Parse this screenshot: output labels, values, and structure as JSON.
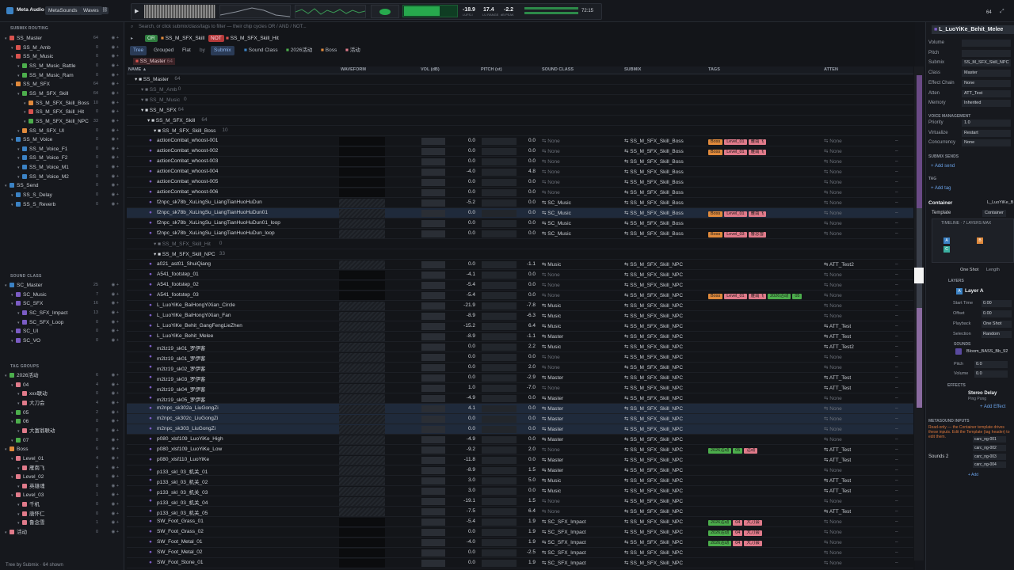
{
  "app": {
    "title": "Meta Audio",
    "tabs": [
      "MetaSounds",
      "Waves"
    ]
  },
  "meters": {
    "lufs_i": "-18.9",
    "lufs_lra": "17.4",
    "lufs_peak": "-2.2",
    "lufs_i_label": "LUFS-I",
    "lra_label": "LU RANGE",
    "peak_label": "dB PEAK",
    "time": "72:15",
    "zoom": "64"
  },
  "sidebar": {
    "routing_title": "SUBMIX ROUTING",
    "routing": [
      {
        "label": "SS_Master",
        "cnt": "64",
        "color": "#d9534f",
        "lvl": 0
      },
      {
        "label": "SS_M_Amb",
        "cnt": "0",
        "color": "#d9534f",
        "lvl": 1
      },
      {
        "label": "SS_M_Music",
        "cnt": "0",
        "color": "#d9534f",
        "lvl": 1
      },
      {
        "label": "SS_M_Music_Battle",
        "cnt": "0",
        "color": "#4cae4c",
        "lvl": 2
      },
      {
        "label": "SS_M_Music_Ram",
        "cnt": "0",
        "color": "#4cae4c",
        "lvl": 2
      },
      {
        "label": "SS_M_SFX",
        "cnt": "64",
        "color": "#e08a3c",
        "lvl": 1
      },
      {
        "label": "SS_M_SFX_Skill",
        "cnt": "64",
        "color": "#4cae4c",
        "lvl": 2
      },
      {
        "label": "SS_M_SFX_Skill_Boss",
        "cnt": "10",
        "color": "#e08a3c",
        "lvl": 3
      },
      {
        "label": "SS_M_SFX_Skill_Hit",
        "cnt": "0",
        "color": "#d9534f",
        "lvl": 3
      },
      {
        "label": "SS_M_SFX_Skill_NPC",
        "cnt": "33",
        "color": "#4cae4c",
        "lvl": 3
      },
      {
        "label": "SS_M_SFX_UI",
        "cnt": "0",
        "color": "#e08a3c",
        "lvl": 2
      },
      {
        "label": "SS_M_Voice",
        "cnt": "0",
        "color": "#3b82c4",
        "lvl": 1
      },
      {
        "label": "SS_M_Voice_F1",
        "cnt": "0",
        "color": "#3b82c4",
        "lvl": 2
      },
      {
        "label": "SS_M_Voice_F2",
        "cnt": "0",
        "color": "#3b82c4",
        "lvl": 2
      },
      {
        "label": "SS_M_Voice_M1",
        "cnt": "0",
        "color": "#3b82c4",
        "lvl": 2
      },
      {
        "label": "SS_M_Voice_M2",
        "cnt": "0",
        "color": "#3b82c4",
        "lvl": 2
      },
      {
        "label": "SS_Send",
        "cnt": "0",
        "color": "#3b82c4",
        "lvl": 0
      },
      {
        "label": "SS_S_Delay",
        "cnt": "0",
        "color": "#3b82c4",
        "lvl": 1
      },
      {
        "label": "SS_S_Reverb",
        "cnt": "0",
        "color": "#3b82c4",
        "lvl": 1
      }
    ],
    "class_title": "SOUND CLASS",
    "classes": [
      {
        "label": "SC_Master",
        "cnt": "25",
        "color": "#3b82c4",
        "lvl": 0
      },
      {
        "label": "SC_Music",
        "cnt": "7",
        "color": "#7b5cc4",
        "lvl": 1
      },
      {
        "label": "SC_SFX",
        "cnt": "16",
        "color": "#7b5cc4",
        "lvl": 1
      },
      {
        "label": "SC_SFX_Impact",
        "cnt": "13",
        "color": "#7b5cc4",
        "lvl": 2
      },
      {
        "label": "SC_SFX_Loop",
        "cnt": "0",
        "color": "#7b5cc4",
        "lvl": 2
      },
      {
        "label": "SC_UI",
        "cnt": "0",
        "color": "#7b5cc4",
        "lvl": 1
      },
      {
        "label": "SC_VO",
        "cnt": "0",
        "color": "#7b5cc4",
        "lvl": 1
      }
    ],
    "tags_title": "TAG GROUPS",
    "tags": [
      {
        "label": "2026活动",
        "cnt": "6",
        "color": "#4cae4c",
        "lvl": 0
      },
      {
        "label": "04",
        "cnt": "4",
        "color": "#e07a8a",
        "lvl": 1
      },
      {
        "label": "xxx联动",
        "cnt": "0",
        "color": "#e07a8a",
        "lvl": 2
      },
      {
        "label": "大刀会",
        "cnt": "4",
        "color": "#e07a8a",
        "lvl": 2
      },
      {
        "label": "05",
        "cnt": "2",
        "color": "#4cae4c",
        "lvl": 1
      },
      {
        "label": "06",
        "cnt": "0",
        "color": "#4cae4c",
        "lvl": 1
      },
      {
        "label": "大富翁联动",
        "cnt": "0",
        "color": "#e07a8a",
        "lvl": 2
      },
      {
        "label": "07",
        "cnt": "0",
        "color": "#4cae4c",
        "lvl": 1
      },
      {
        "label": "Boss",
        "cnt": "6",
        "color": "#e08a3c",
        "lvl": 0
      },
      {
        "label": "Level_01",
        "cnt": "4",
        "color": "#e07a8a",
        "lvl": 1
      },
      {
        "label": "雁南飞",
        "cnt": "4",
        "color": "#e07a8a",
        "lvl": 2
      },
      {
        "label": "Level_02",
        "cnt": "0",
        "color": "#e07a8a",
        "lvl": 1
      },
      {
        "label": "英雄魂",
        "cnt": "0",
        "color": "#e07a8a",
        "lvl": 2
      },
      {
        "label": "Level_03",
        "cnt": "1",
        "color": "#e07a8a",
        "lvl": 1
      },
      {
        "label": "千机",
        "cnt": "0",
        "color": "#e07a8a",
        "lvl": 2
      },
      {
        "label": "唐怀仁",
        "cnt": "0",
        "color": "#e07a8a",
        "lvl": 2
      },
      {
        "label": "鲁念雪",
        "cnt": "1",
        "color": "#e07a8a",
        "lvl": 2
      },
      {
        "label": "活动",
        "cnt": "0",
        "color": "#e07a8a",
        "lvl": 0
      }
    ],
    "status": "Tree by Submix · 64 shown"
  },
  "main": {
    "search_placeholder": "Search, or click submix/class/tags to filter — their chip cycles OR / AND / NOT...",
    "chip_or": "OR",
    "chip_or_val": "SS_M_SFX_Skill",
    "chip_not": "NOT",
    "chip_not_val": "SS_M_SFX_Skill_Hit",
    "views": [
      "Tree",
      "Grouped",
      "Flat"
    ],
    "by": "by",
    "group_chips": [
      "Submix",
      "Sound Class",
      "2026活动",
      "Boss",
      "活动"
    ],
    "crumb": "SS_Master",
    "crumb_cnt": "64",
    "cols": [
      "NAME ▲",
      "WAVEFORM",
      "VOL (dB)",
      "PITCH (st)",
      "SOUND CLASS",
      "SUBMIX",
      "TAGS",
      "ATTEN"
    ]
  },
  "rows": [
    {
      "n": "SS_Master",
      "g": 1,
      "ind": 0,
      "c": "64"
    },
    {
      "n": "SS_M_Amb",
      "g": 1,
      "ind": 1,
      "c": "0",
      "dim": 1
    },
    {
      "n": "SS_M_Music",
      "g": 1,
      "ind": 1,
      "c": "0",
      "dim": 1
    },
    {
      "n": "SS_M_SFX",
      "g": 1,
      "ind": 1,
      "c": "64"
    },
    {
      "n": "SS_M_SFX_Skill",
      "g": 1,
      "ind": 2,
      "c": "64"
    },
    {
      "n": "SS_M_SFX_Skill_Boss",
      "g": 1,
      "ind": 3,
      "c": "10"
    },
    {
      "n": "actionCombat_whoost-001",
      "v": "0.0",
      "p": "0.0",
      "sc": "None",
      "sm": "SS_M_SFX_Skill_Boss",
      "t": [
        "Boss",
        "Level_01",
        "雁南飞"
      ],
      "at": "None",
      "w": 1
    },
    {
      "n": "actionCombat_whoost-002",
      "v": "0.0",
      "p": "0.0",
      "sc": "None",
      "sm": "SS_M_SFX_Skill_Boss",
      "t": [
        "Boss",
        "Level_01",
        "雁南飞"
      ],
      "at": "None",
      "w": 1
    },
    {
      "n": "actionCombat_whoost-003",
      "v": "0.0",
      "p": "0.0",
      "sc": "None",
      "sm": "SS_M_SFX_Skill_Boss",
      "t": [],
      "at": "None",
      "w": 1
    },
    {
      "n": "actionCombat_whoost-004",
      "v": "-4.0",
      "p": "4.8",
      "sc": "None",
      "sm": "SS_M_SFX_Skill_Boss",
      "t": [],
      "at": "None",
      "w": 1
    },
    {
      "n": "actionCombat_whoost-005",
      "v": "0.0",
      "p": "0.0",
      "sc": "None",
      "sm": "SS_M_SFX_Skill_Boss",
      "t": [],
      "at": "None",
      "w": 1
    },
    {
      "n": "actionCombat_whoost-006",
      "v": "0.0",
      "p": "0.0",
      "sc": "None",
      "sm": "SS_M_SFX_Skill_Boss",
      "t": [],
      "at": "None",
      "w": 1
    },
    {
      "n": "f2npc_sk78b_XuLingSu_LiangTianHuoHuDun",
      "v": "-5.2",
      "p": "0.0",
      "sc": "SC_Music",
      "sm": "SS_M_SFX_Skill_Boss",
      "t": [],
      "at": "None"
    },
    {
      "n": "f2npc_sk78b_XuLingSu_LiangTianHuoHuDun01",
      "v": "0.0",
      "p": "0.0",
      "sc": "SC_Music",
      "sm": "SS_M_SFX_Skill_Boss",
      "t": [
        "Boss",
        "Level_01",
        "雁南飞"
      ],
      "at": "None",
      "sel": 1
    },
    {
      "n": "f2npc_sk78b_XuLingSu_LiangTianHuoHuDun01_loop",
      "v": "0.0",
      "p": "0.0",
      "sc": "SC_Music",
      "sm": "SS_M_SFX_Skill_Boss",
      "t": [],
      "at": "None"
    },
    {
      "n": "f2npc_sk78b_XuLingSu_LiangTianHuoHuDun_loop",
      "v": "0.0",
      "p": "0.0",
      "sc": "SC_Music",
      "sm": "SS_M_SFX_Skill_Boss",
      "t": [
        "Boss",
        "Level_03",
        "鲁念雪"
      ],
      "at": "None"
    },
    {
      "n": "SS_M_SFX_Skill_Hit",
      "g": 1,
      "ind": 3,
      "c": "0",
      "dim": 1
    },
    {
      "n": "SS_M_SFX_Skill_NPC",
      "g": 1,
      "ind": 3,
      "c": "33"
    },
    {
      "n": "a021_ast01_ShuiQiang",
      "v": "0.0",
      "p": "-1.1",
      "sc": "Music",
      "sm": "SS_M_SFX_Skill_NPC",
      "t": [],
      "at": "ATT_Test2"
    },
    {
      "n": "A541_footstep_01",
      "v": "-4.1",
      "p": "0.0",
      "sc": "None",
      "sm": "SS_M_SFX_Skill_NPC",
      "t": [],
      "at": "None",
      "w": 1
    },
    {
      "n": "A541_footstep_02",
      "v": "-5.4",
      "p": "0.0",
      "sc": "None",
      "sm": "SS_M_SFX_Skill_NPC",
      "t": [],
      "at": "None",
      "w": 1
    },
    {
      "n": "A541_footstep_03",
      "v": "-5.4",
      "p": "0.0",
      "sc": "None",
      "sm": "SS_M_SFX_Skill_NPC",
      "t": [
        "Boss",
        "Level_01",
        "雁南飞",
        "2026活动",
        "05"
      ],
      "at": "None",
      "w": 1
    },
    {
      "n": "L_LuoYiKe_BaiHongYiXian_Circle",
      "v": "-21.9",
      "p": "-7.8",
      "sc": "Music",
      "sm": "SS_M_SFX_Skill_NPC",
      "t": [],
      "at": "None"
    },
    {
      "n": "L_LuoYiKe_BaiHongYiXian_Fan",
      "v": "-8.9",
      "p": "-6.3",
      "sc": "Music",
      "sm": "SS_M_SFX_Skill_NPC",
      "t": [],
      "at": "None"
    },
    {
      "n": "L_LuoYiKe_Behit_GangFengLieZhen",
      "v": "-15.2",
      "p": "6.4",
      "sc": "Music",
      "sm": "SS_M_SFX_Skill_NPC",
      "t": [],
      "at": "ATT_Test"
    },
    {
      "n": "L_LuoYiKe_Behit_Melee",
      "v": "-8.9",
      "p": "-1.1",
      "sc": "Master",
      "sm": "SS_M_SFX_Skill_NPC",
      "t": [],
      "at": "ATT_Test"
    },
    {
      "n": "m2lz19_sk01_罗伊客",
      "v": "0.0",
      "p": "2.2",
      "sc": "Music",
      "sm": "SS_M_SFX_Skill_NPC",
      "t": [],
      "at": "ATT_Test2"
    },
    {
      "n": "m2lz19_sk01_罗伊客",
      "v": "0.0",
      "p": "0.0",
      "sc": "None",
      "sm": "SS_M_SFX_Skill_NPC",
      "t": [],
      "at": "None"
    },
    {
      "n": "m2lz19_sk02_罗伊客",
      "v": "0.0",
      "p": "2.0",
      "sc": "None",
      "sm": "SS_M_SFX_Skill_NPC",
      "t": [],
      "at": "None"
    },
    {
      "n": "m2lz19_sk03_罗伊客",
      "v": "0.0",
      "p": "-2.9",
      "sc": "Master",
      "sm": "SS_M_SFX_Skill_NPC",
      "t": [],
      "at": "ATT_Test"
    },
    {
      "n": "m2lz19_sk04_罗伊客",
      "v": "1.0",
      "p": "-7.0",
      "sc": "None",
      "sm": "SS_M_SFX_Skill_NPC",
      "t": [],
      "at": "ATT_Test"
    },
    {
      "n": "m2lz19_sk05_罗伊客",
      "v": "-4.9",
      "p": "0.0",
      "sc": "Master",
      "sm": "SS_M_SFX_Skill_NPC",
      "t": [],
      "at": "None"
    },
    {
      "n": "m2npc_sk302a_LiuGongZi",
      "v": "4.1",
      "p": "0.0",
      "sc": "Master",
      "sm": "SS_M_SFX_Skill_NPC",
      "t": [],
      "at": "None",
      "sel": 1
    },
    {
      "n": "m2npc_sk302c_LiuGongZi",
      "v": "0.0",
      "p": "0.0",
      "sc": "Master",
      "sm": "SS_M_SFX_Skill_NPC",
      "t": [],
      "at": "None",
      "sel": 1
    },
    {
      "n": "m2npc_sk303_LiuGongZi",
      "v": "0.0",
      "p": "0.0",
      "sc": "Master",
      "sm": "SS_M_SFX_Skill_NPC",
      "t": [],
      "at": "None",
      "sel": 1
    },
    {
      "n": "p080_xlsf109_LuoYiKe_High",
      "v": "-4.9",
      "p": "0.0",
      "sc": "Master",
      "sm": "SS_M_SFX_Skill_NPC",
      "t": [],
      "at": "None"
    },
    {
      "n": "p080_xlsf109_LuoYiKe_Low",
      "v": "-9.2",
      "p": "2.0",
      "sc": "None",
      "sm": "SS_M_SFX_Skill_NPC",
      "t": [
        "2026活动",
        "05",
        "活动"
      ],
      "at": "ATT_Test"
    },
    {
      "n": "p080_xlsf110_LuoYiKe",
      "v": "-11.8",
      "p": "0.0",
      "sc": "Master",
      "sm": "SS_M_SFX_Skill_NPC",
      "t": [],
      "at": "ATT_Test"
    },
    {
      "n": "p133_skl_03_机关_01",
      "v": "-8.9",
      "p": "1.5",
      "sc": "Master",
      "sm": "SS_M_SFX_Skill_NPC",
      "t": [],
      "at": "None"
    },
    {
      "n": "p133_skl_03_机关_02",
      "v": "3.0",
      "p": "5.0",
      "sc": "Music",
      "sm": "SS_M_SFX_Skill_NPC",
      "t": [],
      "at": "ATT_Test"
    },
    {
      "n": "p133_skl_03_机关_03",
      "v": "3.0",
      "p": "0.0",
      "sc": "Music",
      "sm": "SS_M_SFX_Skill_NPC",
      "t": [],
      "at": "ATT_Test"
    },
    {
      "n": "p133_skl_03_机关_04",
      "v": "-19.1",
      "p": "1.5",
      "sc": "None",
      "sm": "SS_M_SFX_Skill_NPC",
      "t": [],
      "at": "None"
    },
    {
      "n": "p133_skl_03_机关_05",
      "v": "-7.5",
      "p": "6.4",
      "sc": "None",
      "sm": "SS_M_SFX_Skill_NPC",
      "t": [],
      "at": "ATT_Test"
    },
    {
      "n": "SW_Foot_Grass_01",
      "v": "-5.4",
      "p": "1.9",
      "sc": "SC_SFX_Impact",
      "sm": "SS_M_SFX_Skill_NPC",
      "t": [
        "2026活动",
        "04",
        "大刀会"
      ],
      "at": "None",
      "w": 1
    },
    {
      "n": "SW_Foot_Grass_02",
      "v": "0.0",
      "p": "1.9",
      "sc": "SC_SFX_Impact",
      "sm": "SS_M_SFX_Skill_NPC",
      "t": [
        "2026活动",
        "04",
        "大刀会"
      ],
      "at": "None",
      "w": 1
    },
    {
      "n": "SW_Foot_Metal_01",
      "v": "-4.0",
      "p": "1.9",
      "sc": "SC_SFX_Impact",
      "sm": "SS_M_SFX_Skill_NPC",
      "t": [
        "2026活动",
        "04",
        "大刀会"
      ],
      "at": "None",
      "w": 1
    },
    {
      "n": "SW_Foot_Metal_02",
      "v": "0.0",
      "p": "-2.5",
      "sc": "SC_SFX_Impact",
      "sm": "SS_M_SFX_Skill_NPC",
      "t": [],
      "at": "None",
      "w": 1
    },
    {
      "n": "SW_Foot_Stone_01",
      "v": "0.0",
      "p": "1.9",
      "sc": "SC_SFX_Impact",
      "sm": "SS_M_SFX_Skill_NPC",
      "t": [],
      "at": "None",
      "w": 1
    }
  ],
  "inspector": {
    "title": "L_LuoYiKe_Behit_Melee",
    "fields": [
      {
        "k": "Volume",
        "v": ""
      },
      {
        "k": "Pitch",
        "v": ""
      },
      {
        "k": "Submix",
        "v": "SS_M_SFX_Skill_NPC"
      },
      {
        "k": "Class",
        "v": "Master"
      },
      {
        "k": "Effect Chain",
        "v": "None"
      },
      {
        "k": "Atten",
        "v": "ATT_Test"
      },
      {
        "k": "Memory",
        "v": "Inherited"
      }
    ],
    "voice_title": "VOICE MANAGEMENT",
    "voice": [
      {
        "k": "Priority",
        "v": "1.0"
      },
      {
        "k": "Virtualize",
        "v": "Restart"
      },
      {
        "k": "Concurrency",
        "v": "None"
      }
    ],
    "sends_title": "SUBMIX SENDS",
    "add_send": "+ Add send",
    "tag_title": "TAG",
    "add_tag": "+ Add tag",
    "container": "Container",
    "container_val": "L_LuoYiKe_B",
    "template": "Template",
    "template_val": "Container",
    "timeline": "TIMELINE · 7 LAYERS MAX",
    "oneshot": "One Shot",
    "length": "Length",
    "layers_title": "LAYERS",
    "layer": "Layer A",
    "layer_fields": [
      {
        "k": "Start Time",
        "v": "0.00"
      },
      {
        "k": "Offset",
        "v": "0.00"
      },
      {
        "k": "Playback",
        "v": "One Shot"
      },
      {
        "k": "Selection",
        "v": "Random"
      }
    ],
    "sounds_title": "SOUNDS",
    "sound": "Bloom_BASS_Bb_92",
    "sound_fields": [
      {
        "k": "Pitch",
        "v": "0.0"
      },
      {
        "k": "Volume",
        "v": "0.0"
      }
    ],
    "effects_title": "EFFECTS",
    "effect": "Stereo Delay",
    "effect_sub": "Ping Pong",
    "add_effect": "+ Add Effect",
    "inputs_title": "METASOUND INPUTS",
    "inputs_note": "Read-only — the Container template drives these inputs. Edit the Template (tag header) to edit them.",
    "sounds2": "Sounds 2",
    "input_vals": [
      "carc_ng-001",
      "carc_ng-002",
      "carc_ng-003",
      "carc_ng-004"
    ],
    "add": "+ Add"
  }
}
